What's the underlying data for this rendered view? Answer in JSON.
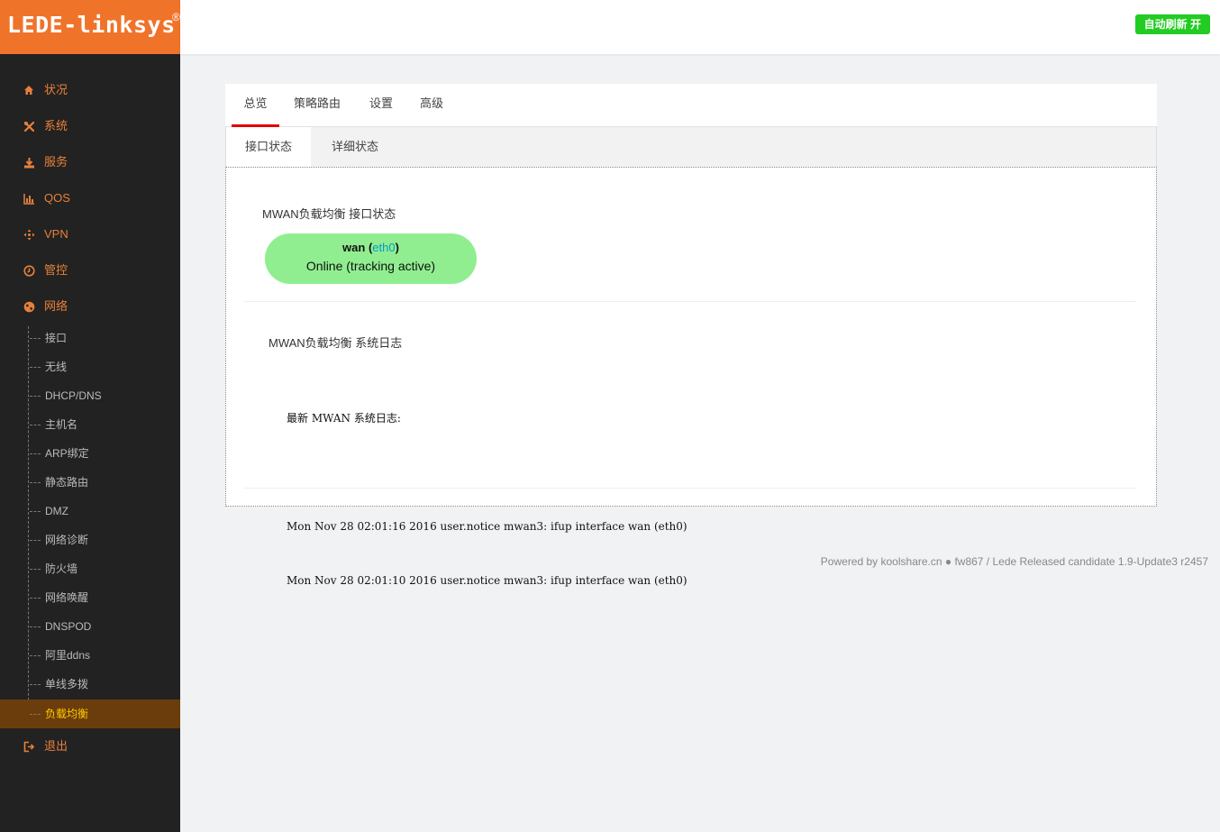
{
  "brand": {
    "title": "LEDE-linksys",
    "reg": "®"
  },
  "header": {
    "refresh_label": "自动刷新 开"
  },
  "sidebar": {
    "menu": [
      {
        "label": "状况",
        "icon": "home-icon"
      },
      {
        "label": "系统",
        "icon": "tools-icon"
      },
      {
        "label": "服务",
        "icon": "download-icon"
      },
      {
        "label": "QOS",
        "icon": "bar-chart-icon"
      },
      {
        "label": "VPN",
        "icon": "arrows-icon"
      },
      {
        "label": "管控",
        "icon": "clock-icon"
      },
      {
        "label": "网络",
        "icon": "globe-icon"
      }
    ],
    "network_sub": [
      "接口",
      "无线",
      "DHCP/DNS",
      "主机名",
      "ARP绑定",
      "静态路由",
      "DMZ",
      "网络诊断",
      "防火墙",
      "网络唤醒",
      "DNSPOD",
      "阿里ddns",
      "单线多拨",
      "负载均衡"
    ],
    "logout": {
      "label": "退出",
      "icon": "logout-icon"
    }
  },
  "tabs": [
    "总览",
    "策略路由",
    "设置",
    "高级"
  ],
  "subtabs": [
    "接口状态",
    "详细状态"
  ],
  "interface_section": {
    "title": "MWAN负载均衡 接口状态",
    "iface_name": "wan",
    "iface_device": "eth0",
    "iface_status": "Online (tracking active)"
  },
  "log_section": {
    "title": "MWAN负载均衡 系统日志",
    "heading": "最新 MWAN 系统日志:",
    "lines": [
      "Mon Nov 28 02:01:16 2016 user.notice mwan3: ifup interface wan (eth0)",
      "Mon Nov 28 02:01:10 2016 user.notice mwan3: ifup interface wan (eth0)"
    ]
  },
  "footer": {
    "text": "Powered by koolshare.cn ● fw867 / Lede Released candidate 1.9-Update3 r2457"
  },
  "colors": {
    "brand": "#f0732a",
    "sidebar": "#222222",
    "menu_text": "#e8803a",
    "active_bg": "#6b3d0c",
    "active_text": "#ffcc00",
    "online": "#90ee90",
    "tab_active": "#e00000",
    "refresh": "#22cc22"
  }
}
